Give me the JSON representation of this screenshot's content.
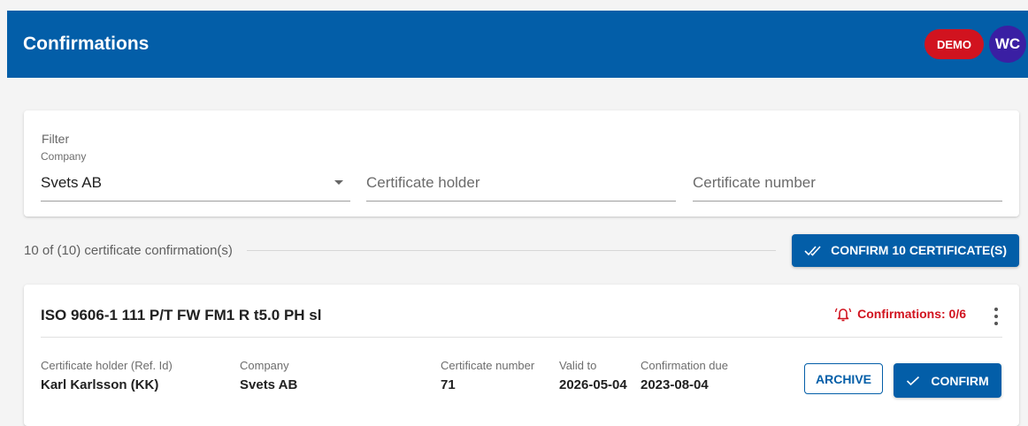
{
  "header": {
    "title": "Confirmations",
    "demo_badge": "DEMO",
    "user_initials": "WC",
    "colors": {
      "bar": "#035ea8",
      "demo": "#d1131f",
      "avatar": "#3a1fa3"
    }
  },
  "filter": {
    "heading": "Filter",
    "company": {
      "label": "Company",
      "value": "Svets AB"
    },
    "holder": {
      "placeholder": "Certificate holder"
    },
    "number": {
      "placeholder": "Certificate number"
    }
  },
  "summary": {
    "text": "10 of (10) certificate confirmation(s)",
    "confirm_all_label": "CONFIRM 10 CERTIFICATE(S)",
    "confirm_all_icon": "double-check-icon"
  },
  "certificate": {
    "title": "ISO 9606-1 111 P/T FW FM1 R t5.0 PH sl",
    "status": "Confirmations: 0/6",
    "status_icon": "alarm-bell-icon",
    "columns": {
      "holder": {
        "label": "Certificate holder (Ref. Id)",
        "value": "Karl Karlsson (KK)"
      },
      "company": {
        "label": "Company",
        "value": "Svets AB"
      },
      "number": {
        "label": "Certificate number",
        "value": "71"
      },
      "valid_to": {
        "label": "Valid to",
        "value": "2026-05-04"
      },
      "due": {
        "label": "Confirmation due",
        "value": "2023-08-04"
      }
    },
    "archive_label": "ARCHIVE",
    "confirm_label": "CONFIRM",
    "confirm_icon": "check-icon"
  }
}
